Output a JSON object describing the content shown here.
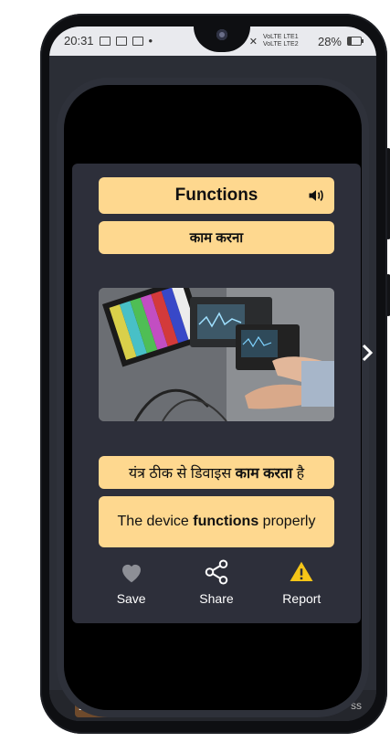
{
  "status_bar": {
    "time": "20:31",
    "signal_text": "VoLTE LTE1 VoLTE LTE2",
    "battery_percent": "28%",
    "battery_level": 0.28
  },
  "background": {
    "title_fragment": "Dip",
    "right_fragment": "ss"
  },
  "card": {
    "word": "Functions",
    "meaning": "काम करना",
    "example_hindi_prefix": "यंत्र ठीक से डिवाइस ",
    "example_hindi_bold": "काम करता",
    "example_hindi_suffix": " है",
    "example_english_prefix": "The device ",
    "example_english_bold": "functions",
    "example_english_suffix": " properly"
  },
  "actions": {
    "save": "Save",
    "share": "Share",
    "report": "Report"
  },
  "icons": {
    "speaker": "speaker-icon",
    "next": "chevron-right-icon",
    "save": "heart-icon",
    "share": "share-icon",
    "report": "warning-icon"
  },
  "colors": {
    "accent": "#fed88f",
    "card_bg": "#2d2f3a",
    "warning": "#f5c518"
  }
}
